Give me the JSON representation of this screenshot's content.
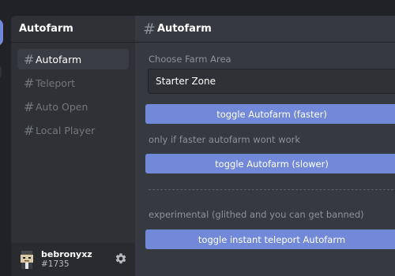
{
  "sidebar": {
    "title": "Autofarm",
    "channels": [
      {
        "label": "Autofarm"
      },
      {
        "label": "Teleport"
      },
      {
        "label": "Auto Open"
      },
      {
        "label": "Local Player"
      }
    ]
  },
  "user": {
    "name": "bebronyxz",
    "tag": "#1735"
  },
  "main": {
    "title": "Autofarm",
    "farm_area_label": "Choose Farm Area",
    "farm_area_value": "Starter Zone",
    "btn_faster": "toggle Autofarm (faster)",
    "note_faster": "only if faster autofarm wont work",
    "btn_slower": "toggle Autofarm (slower)",
    "note_experimental": "experimental (glithed and you can get banned)",
    "btn_instant": "toggle instant teleport Autofarm"
  },
  "colors": {
    "accent": "#7289da",
    "background": "#36393f",
    "sidebar": "#2f3136",
    "frame": "#202225"
  },
  "icons": {
    "channel": "hash-icon",
    "settings": "gear-icon",
    "avatar": "avatar"
  }
}
